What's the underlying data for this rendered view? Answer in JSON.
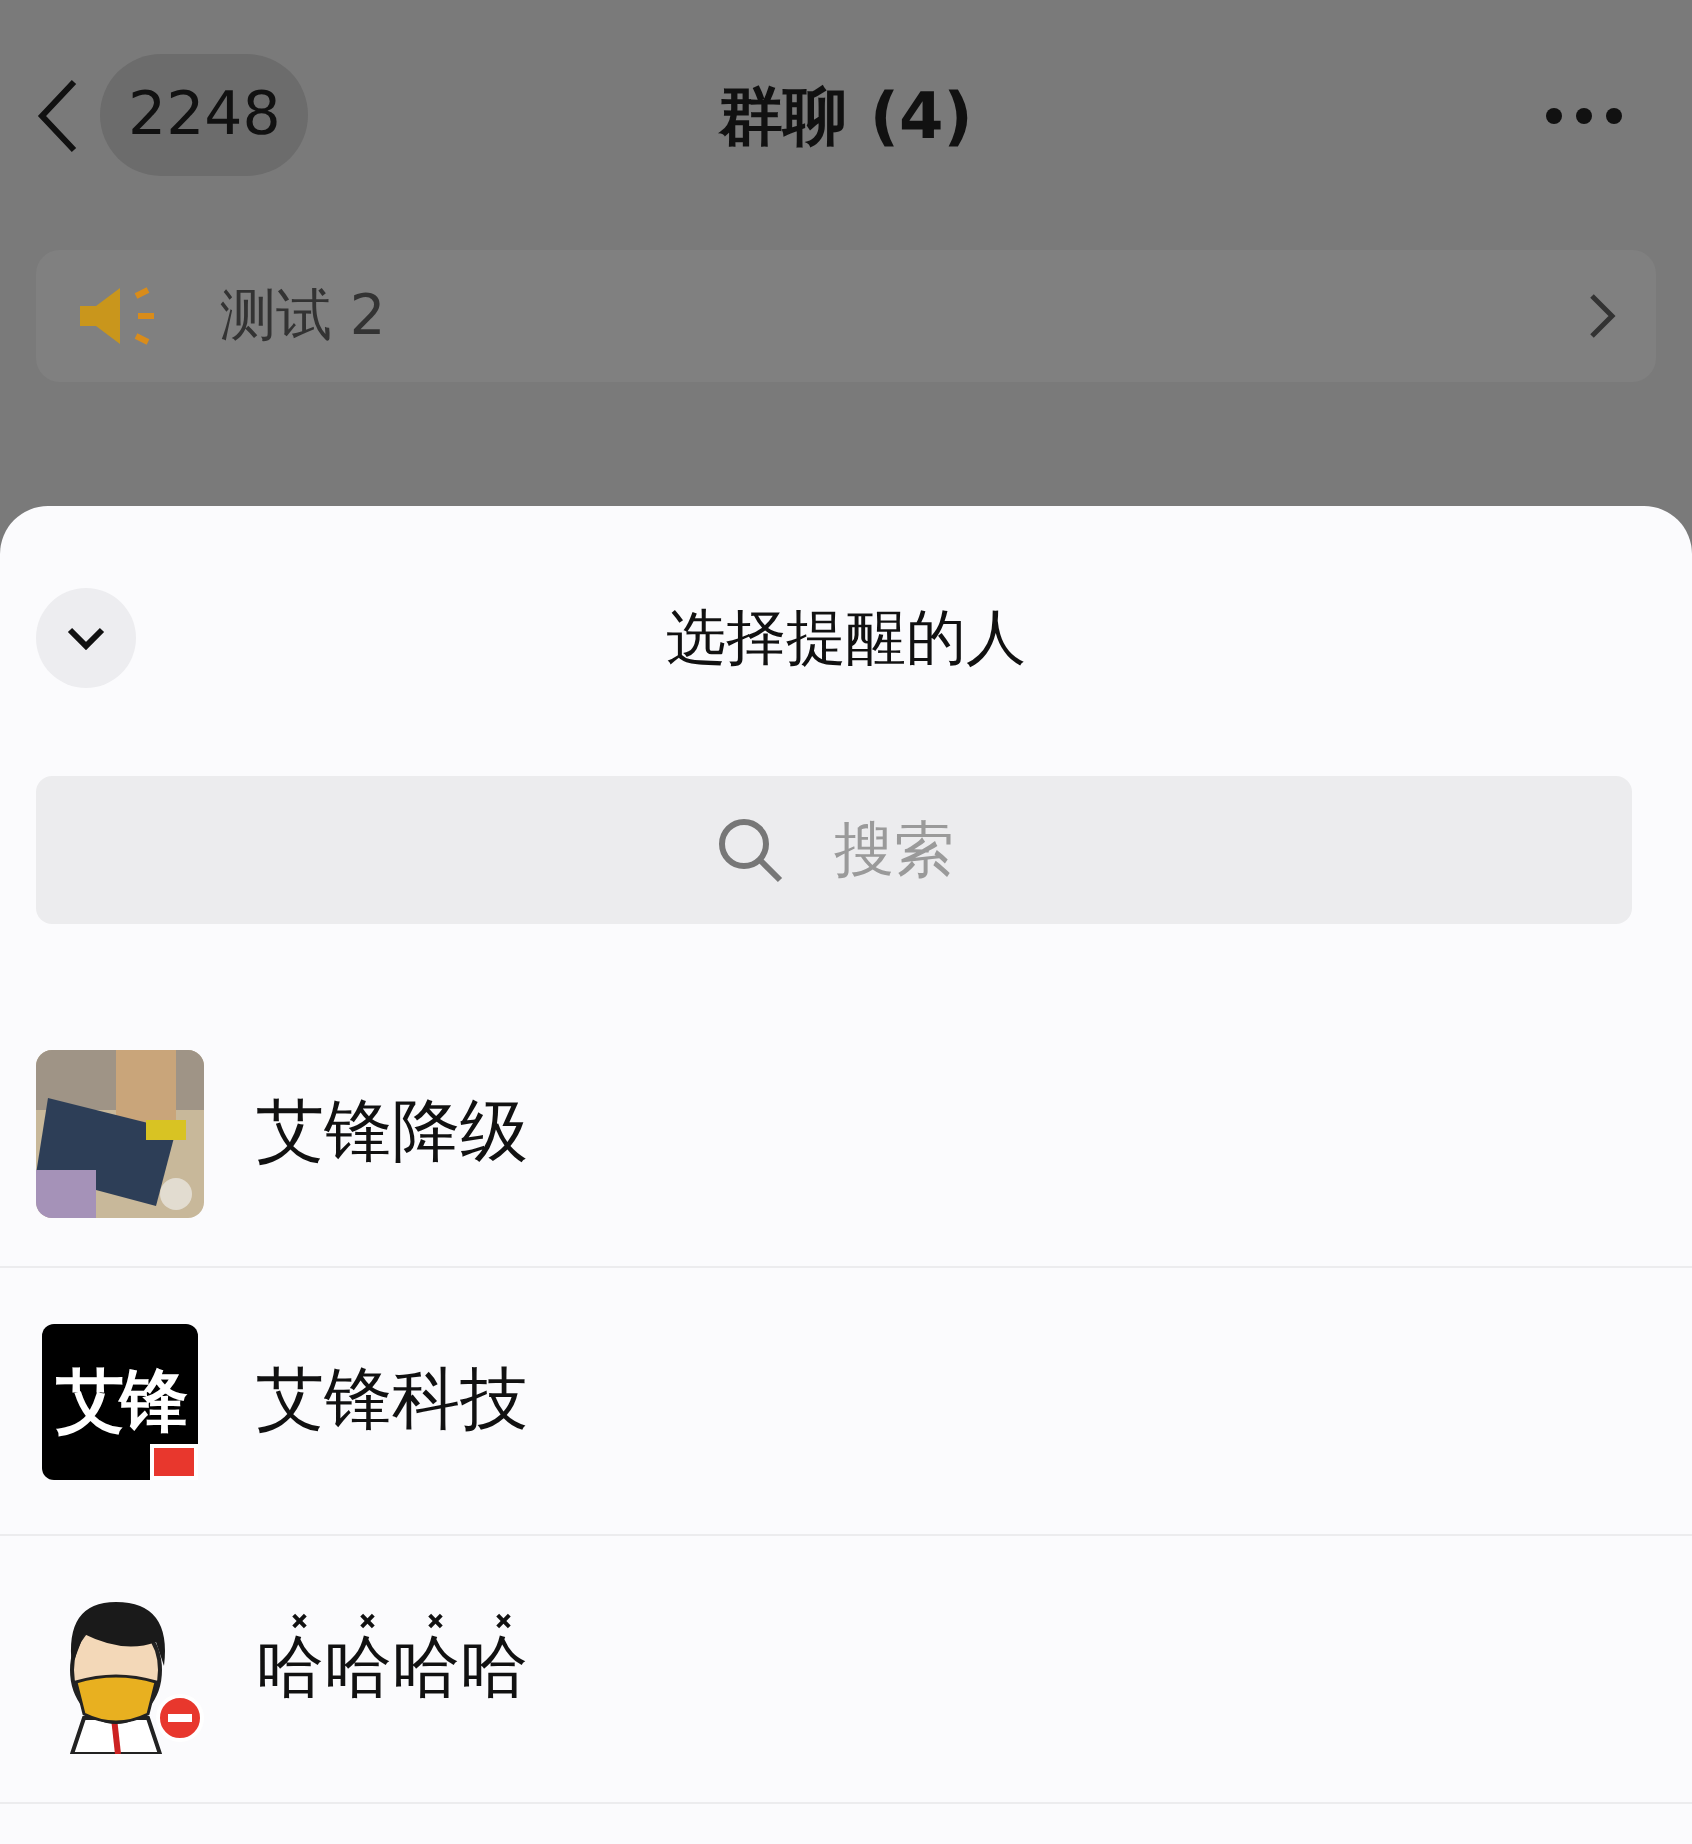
{
  "header": {
    "back_count": "2248",
    "title": "群聊 (4)"
  },
  "announcement": {
    "text": "测试 2"
  },
  "sheet": {
    "title": "选择提醒的人",
    "search": {
      "placeholder": "搜索"
    },
    "members": [
      {
        "name": "艾锋降级"
      },
      {
        "name": "艾锋科技",
        "avatar": {
          "kind": "logo",
          "text": "艾锋",
          "flag_badge": true
        }
      },
      {
        "name": "哈̽哈̽哈̽哈̽",
        "avatar": {
          "kind": "cartoon",
          "blocked_badge": true
        }
      }
    ]
  }
}
